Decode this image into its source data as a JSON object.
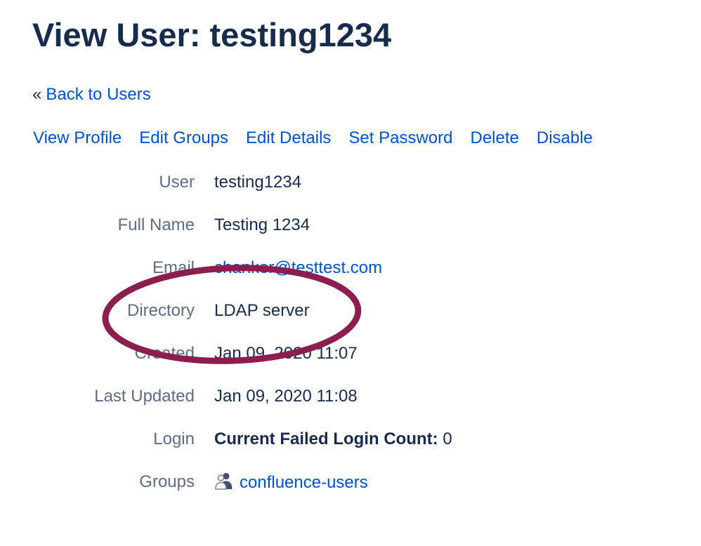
{
  "page": {
    "title": "View User: testing1234"
  },
  "nav": {
    "back_prefix": "«",
    "back_label": "Back to Users"
  },
  "actions": [
    "View Profile",
    "Edit Groups",
    "Edit Details",
    "Set Password",
    "Delete",
    "Disable"
  ],
  "details": {
    "user": {
      "label": "User",
      "value": "testing1234"
    },
    "full_name": {
      "label": "Full Name",
      "value": "Testing 1234"
    },
    "email": {
      "label": "Email",
      "value": "chanker@testtest.com"
    },
    "directory": {
      "label": "Directory",
      "value": "LDAP server"
    },
    "created": {
      "label": "Created",
      "value": "Jan 09, 2020 11:07"
    },
    "last_updated": {
      "label": "Last Updated",
      "value": "Jan 09, 2020 11:08"
    },
    "login": {
      "label": "Login",
      "strong": "Current Failed Login Count:",
      "count": "0"
    },
    "groups": {
      "label": "Groups",
      "icon": "group-icon",
      "value": "confluence-users"
    }
  },
  "annotation": {
    "shape": "ellipse",
    "color": "#8b1e4e",
    "target": "directory"
  },
  "colors": {
    "link": "#0052cc",
    "heading": "#172b4d",
    "label": "#5e6c84"
  }
}
